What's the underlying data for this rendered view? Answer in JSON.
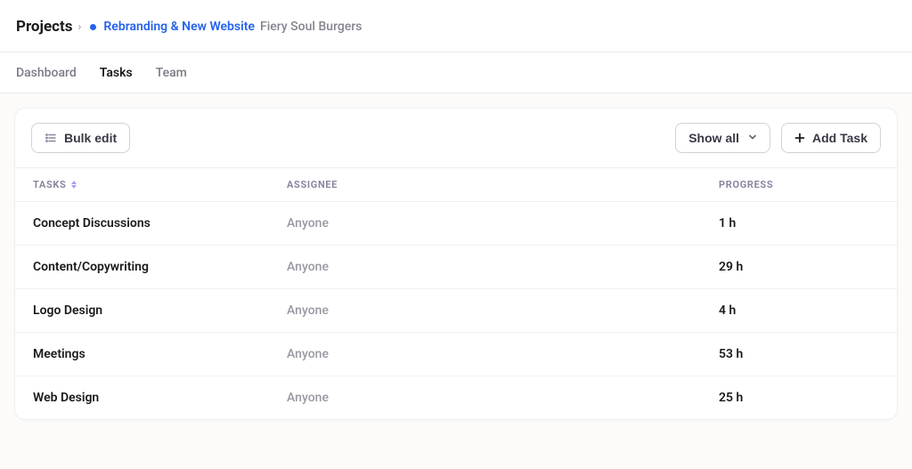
{
  "breadcrumb": {
    "root": "Projects",
    "project_name": "Rebranding & New Website",
    "client_name": "Fiery Soul Burgers",
    "status_color": "#2563eb"
  },
  "tabs": [
    {
      "label": "Dashboard",
      "active": false
    },
    {
      "label": "Tasks",
      "active": true
    },
    {
      "label": "Team",
      "active": false
    }
  ],
  "toolbar": {
    "bulk_edit_label": "Bulk edit",
    "show_all_label": "Show all",
    "add_task_label": "Add Task"
  },
  "table": {
    "columns": {
      "tasks": "Tasks",
      "assignee": "Assignee",
      "progress": "Progress"
    },
    "rows": [
      {
        "name": "Concept Discussions",
        "assignee": "Anyone",
        "progress": "1 h"
      },
      {
        "name": "Content/Copywriting",
        "assignee": "Anyone",
        "progress": "29 h"
      },
      {
        "name": "Logo Design",
        "assignee": "Anyone",
        "progress": "4 h"
      },
      {
        "name": "Meetings",
        "assignee": "Anyone",
        "progress": "53 h"
      },
      {
        "name": "Web Design",
        "assignee": "Anyone",
        "progress": "25 h"
      }
    ]
  }
}
